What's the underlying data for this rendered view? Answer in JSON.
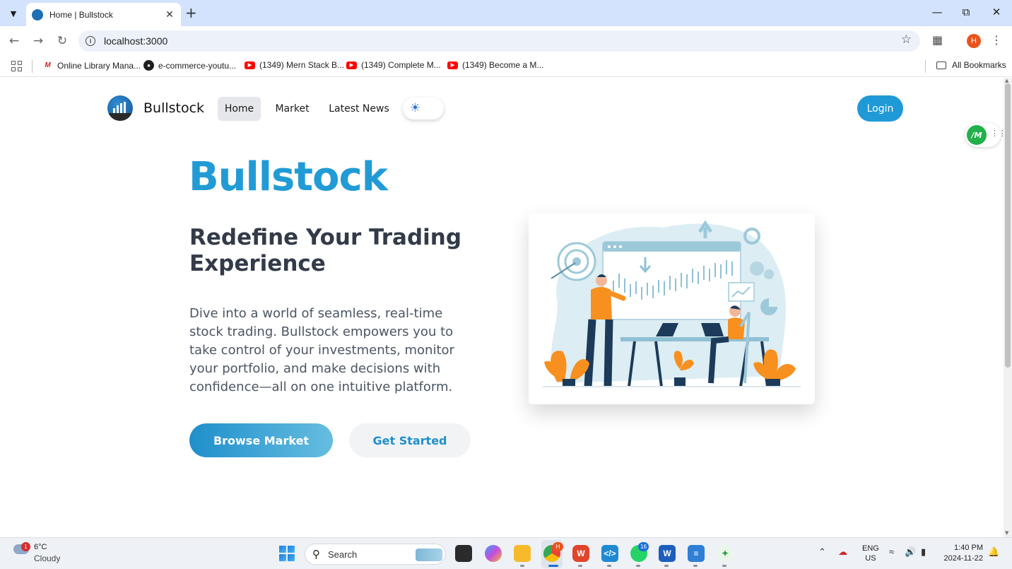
{
  "browser": {
    "tab_title": "Home | Bullstock",
    "url": "localhost:3000",
    "profile_initial": "H",
    "bookmarks": [
      {
        "label": "Online Library Mana...",
        "icon": "library-icon"
      },
      {
        "label": "e-commerce-youtu...",
        "icon": "github-icon"
      },
      {
        "label": "(1349) Mern Stack B...",
        "icon": "youtube-icon"
      },
      {
        "label": "(1349) Complete M...",
        "icon": "youtube-icon"
      },
      {
        "label": "(1349) Become a M...",
        "icon": "youtube-icon"
      }
    ],
    "all_bookmarks_label": "All Bookmarks"
  },
  "navbar": {
    "brand": "Bullstock",
    "links": [
      "Home",
      "Market",
      "Latest News"
    ],
    "active_link": "Home",
    "login_label": "Login"
  },
  "floating_extension": {
    "label": "/M"
  },
  "hero": {
    "title": "Bullstock",
    "subtitle": "Redefine Your Trading Experience",
    "description": "Dive into a world of seamless, real-time stock trading. Bullstock empowers you to take control of your investments, monitor your portfolio, and make decisions with confidence—all on one intuitive platform.",
    "browse_label": "Browse Market",
    "get_started_label": "Get Started"
  },
  "taskbar": {
    "weather_temp": "6°C",
    "weather_desc": "Cloudy",
    "weather_badge": "1",
    "search_label": "Search",
    "chrome_badge": "H",
    "whatsapp_badge": "16",
    "lang_1": "ENG",
    "lang_2": "US",
    "time": "1:40 PM",
    "date": "2024-11-22"
  },
  "colors": {
    "accent": "#219bd5",
    "heading": "#333b49",
    "illustration_orange": "#f7901e",
    "illustration_navy": "#1c3b5a"
  }
}
